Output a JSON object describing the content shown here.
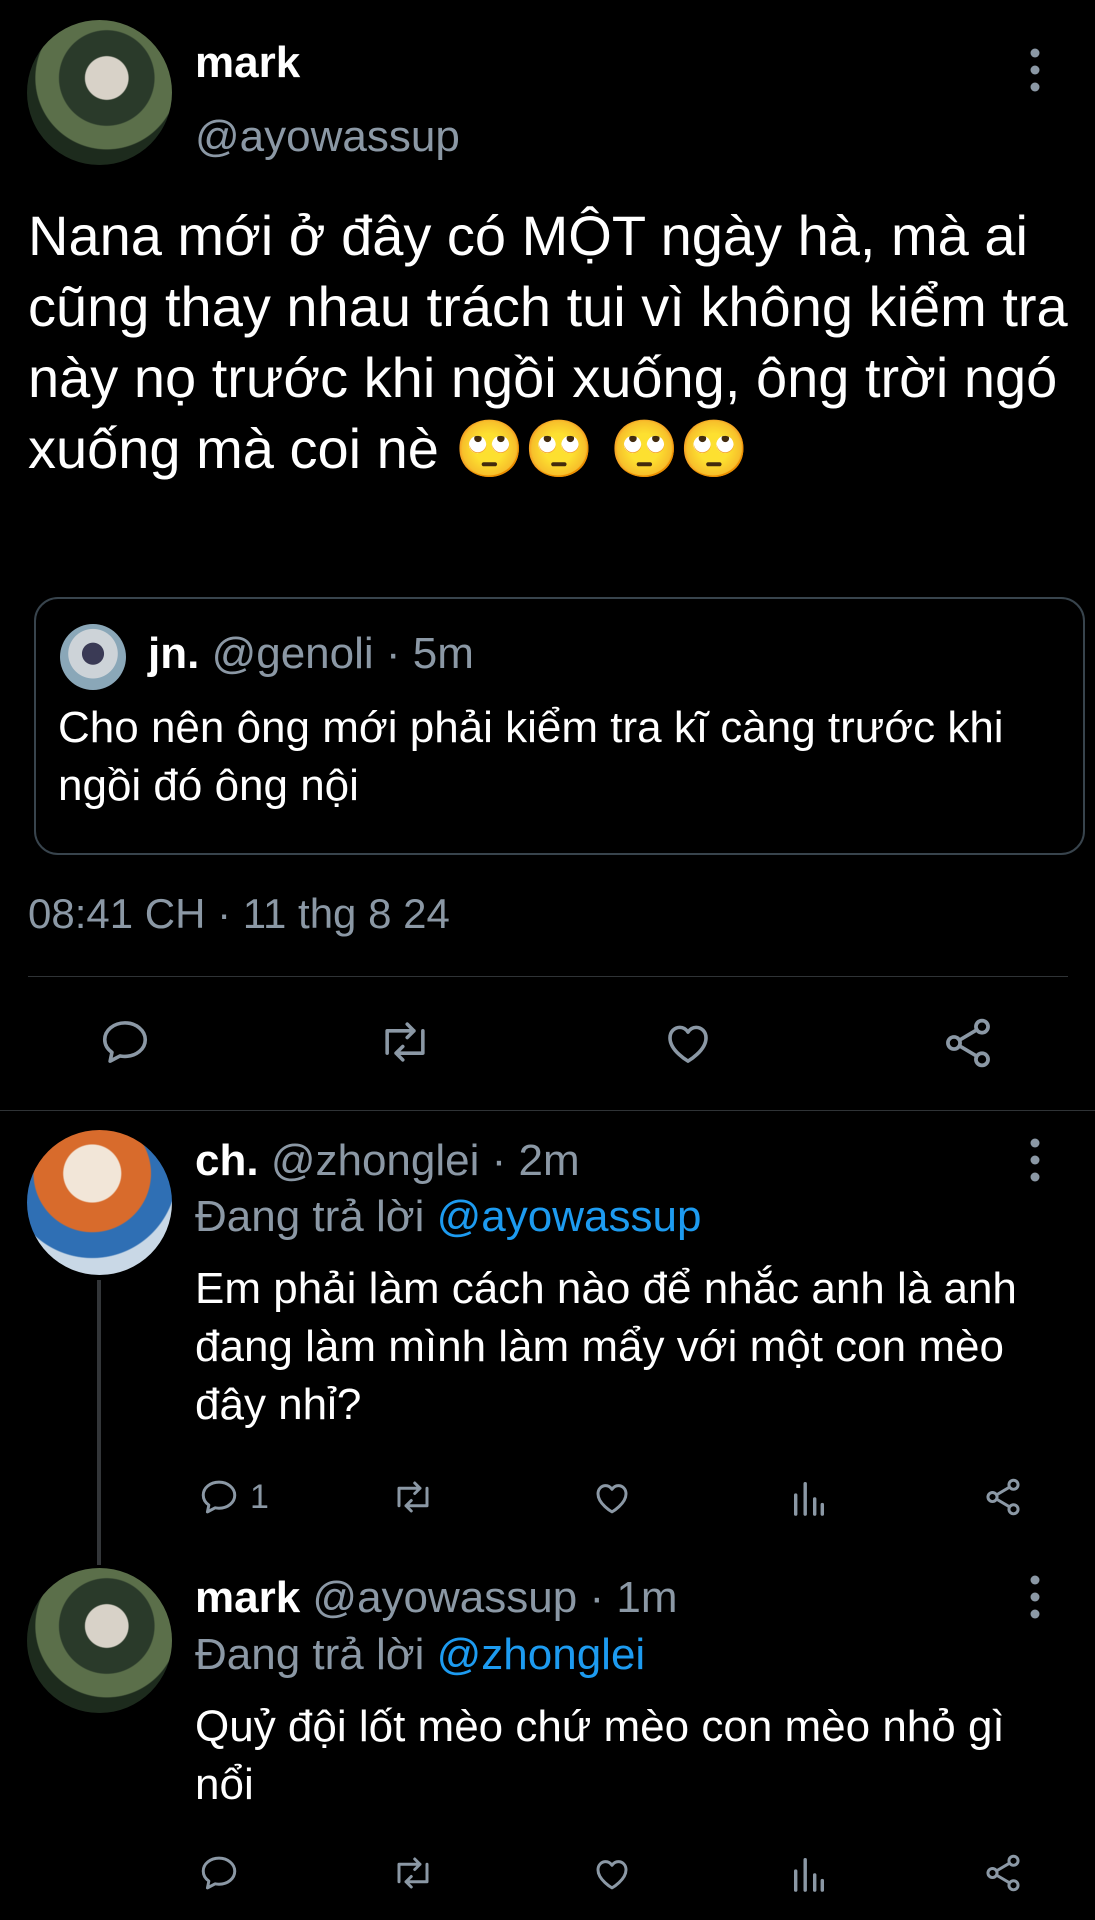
{
  "main_tweet": {
    "display_name": "mark",
    "handle": "@ayowassup",
    "text": "Nana mới ở đây có MỘT ngày hà, mà ai cũng thay nhau trách tui vì không kiểm tra này nọ trước khi ngồi xuống, ông trời ngó xuống mà coi nè 🙄🙄 🙄🙄",
    "quoted": {
      "display_name": "jn.",
      "handle": "@genoli",
      "time": "5m",
      "text": "Cho nên ông mới phải kiểm tra kĩ càng trước khi ngồi đó ông nội"
    },
    "timestamp": "08:41 CH · 11 thg 8 24"
  },
  "replies": [
    {
      "display_name": "ch.",
      "handle": "@zhonglei",
      "time": "2m",
      "replying_label": "Đang trả lời",
      "replying_to": "@ayowassup",
      "text": "Em phải làm cách nào để nhắc anh là anh đang làm mình làm mẩy với một con mèo đây nhỉ?",
      "reply_count": "1"
    },
    {
      "display_name": "mark",
      "handle": "@ayowassup",
      "time": "1m",
      "replying_label": "Đang trả lời",
      "replying_to": "@zhonglei",
      "text": "Quỷ đội lốt mèo chứ mèo con mèo nhỏ gì nổi"
    }
  ],
  "separator": "·",
  "icons": {
    "more": "more-vertical-icon",
    "reply": "reply-icon",
    "retweet": "retweet-icon",
    "like": "heart-icon",
    "share": "share-icon",
    "views": "views-icon"
  },
  "colors": {
    "background": "#000000",
    "text": "#e7e9ea",
    "muted": "#8b98a5",
    "link": "#1d9bf0"
  }
}
